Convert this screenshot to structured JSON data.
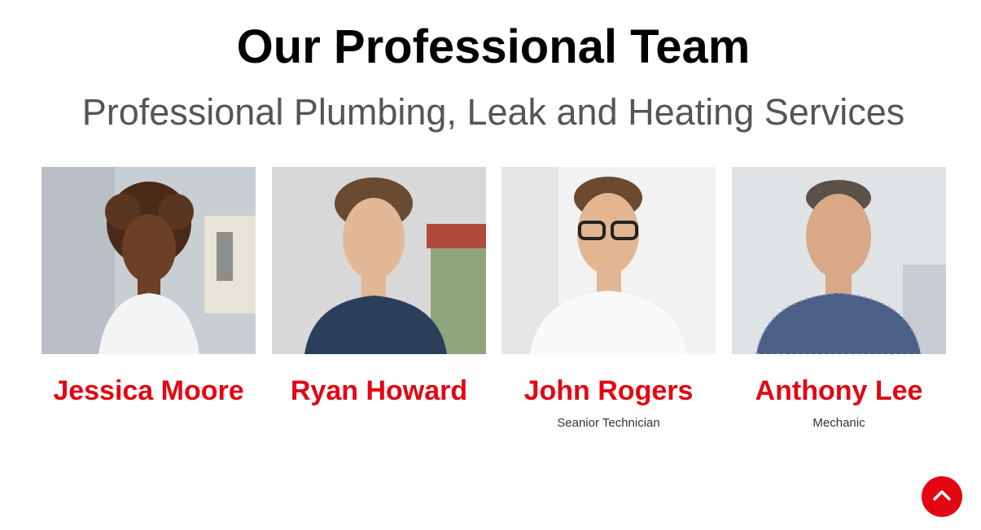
{
  "section": {
    "title": "Our Professional Team",
    "subtitle": "Professional Plumbing, Leak and Heating Services"
  },
  "team": [
    {
      "name": "Jessica Moore",
      "role": "",
      "photo_icon": "person-photo"
    },
    {
      "name": "Ryan Howard",
      "role": "",
      "photo_icon": "person-photo"
    },
    {
      "name": "John Rogers",
      "role": "Seanior Technician",
      "photo_icon": "person-photo"
    },
    {
      "name": "Anthony Lee",
      "role": "Mechanic",
      "photo_icon": "person-photo"
    }
  ],
  "colors": {
    "accent": "#e30613",
    "subtitle": "#555555"
  },
  "scroll_top": {
    "icon": "chevron-up-icon"
  }
}
